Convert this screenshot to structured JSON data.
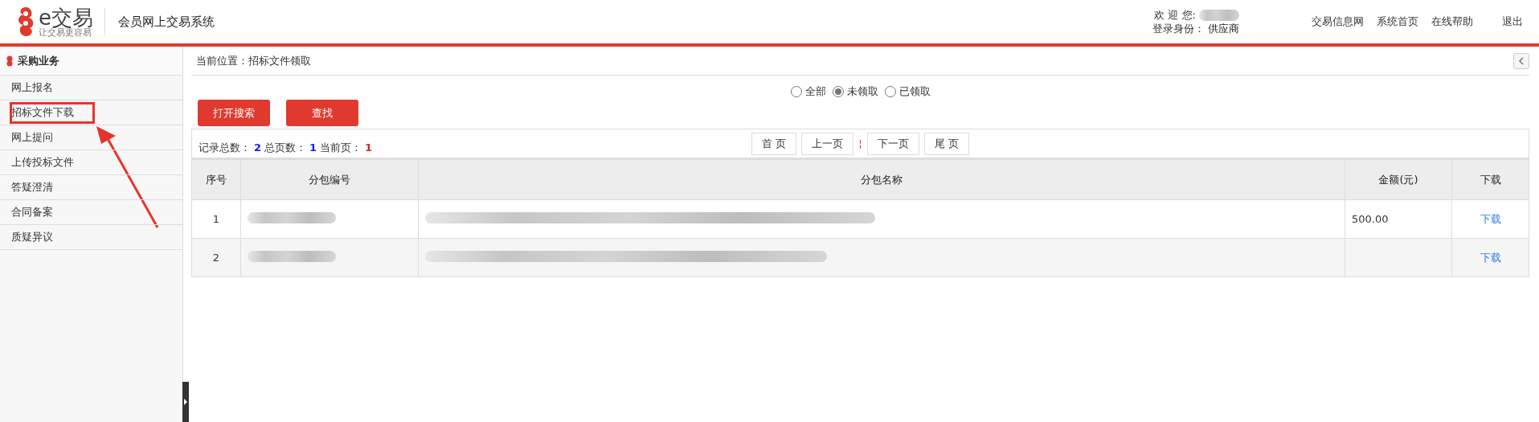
{
  "header": {
    "logo_text": "e交易",
    "logo_slogan": "让交易更容易",
    "system_title": "会员网上交易系统",
    "welcome_label": "欢 迎 您:",
    "role_label": "登录身份：",
    "role": "供应商",
    "links": [
      "交易信息网",
      "系统首页",
      "在线帮助",
      "退出"
    ]
  },
  "sidebar": {
    "title": "采购业务",
    "items": [
      {
        "label": "网上报名",
        "annotated": false
      },
      {
        "label": "招标文件下载",
        "annotated": true
      },
      {
        "label": "网上提问",
        "annotated": false
      },
      {
        "label": "上传投标文件",
        "annotated": false
      },
      {
        "label": "答疑澄清",
        "annotated": false
      },
      {
        "label": "合同备案",
        "annotated": false
      },
      {
        "label": "质疑异议",
        "annotated": false
      }
    ]
  },
  "breadcrumb": "当前位置：招标文件领取",
  "filters": [
    {
      "label": "全部",
      "selected": false
    },
    {
      "label": "未领取",
      "selected": true
    },
    {
      "label": "已领取",
      "selected": false
    }
  ],
  "buttons": [
    "打开搜索",
    "查找"
  ],
  "summary": [
    {
      "label": "记录总数：",
      "value": "2",
      "color": "#1a1aff"
    },
    {
      "label": "总页数：",
      "value": "1",
      "color": "#1a1aff"
    },
    {
      "label": "当前页：",
      "value": "1",
      "color": "#e02020"
    }
  ],
  "pager": [
    {
      "kind": "button",
      "label": "首 页"
    },
    {
      "kind": "button",
      "label": "上一页"
    },
    {
      "kind": "separator",
      "label": "¦"
    },
    {
      "kind": "button",
      "label": "下一页"
    },
    {
      "kind": "button",
      "label": "尾 页"
    }
  ],
  "table": {
    "columns": [
      "序号",
      "分包编号",
      "分包名称",
      "金额(元)",
      "下载"
    ],
    "rows": [
      {
        "index": "1",
        "amount": "500.00",
        "download": "下载"
      },
      {
        "index": "2",
        "download": "下载"
      }
    ]
  }
}
